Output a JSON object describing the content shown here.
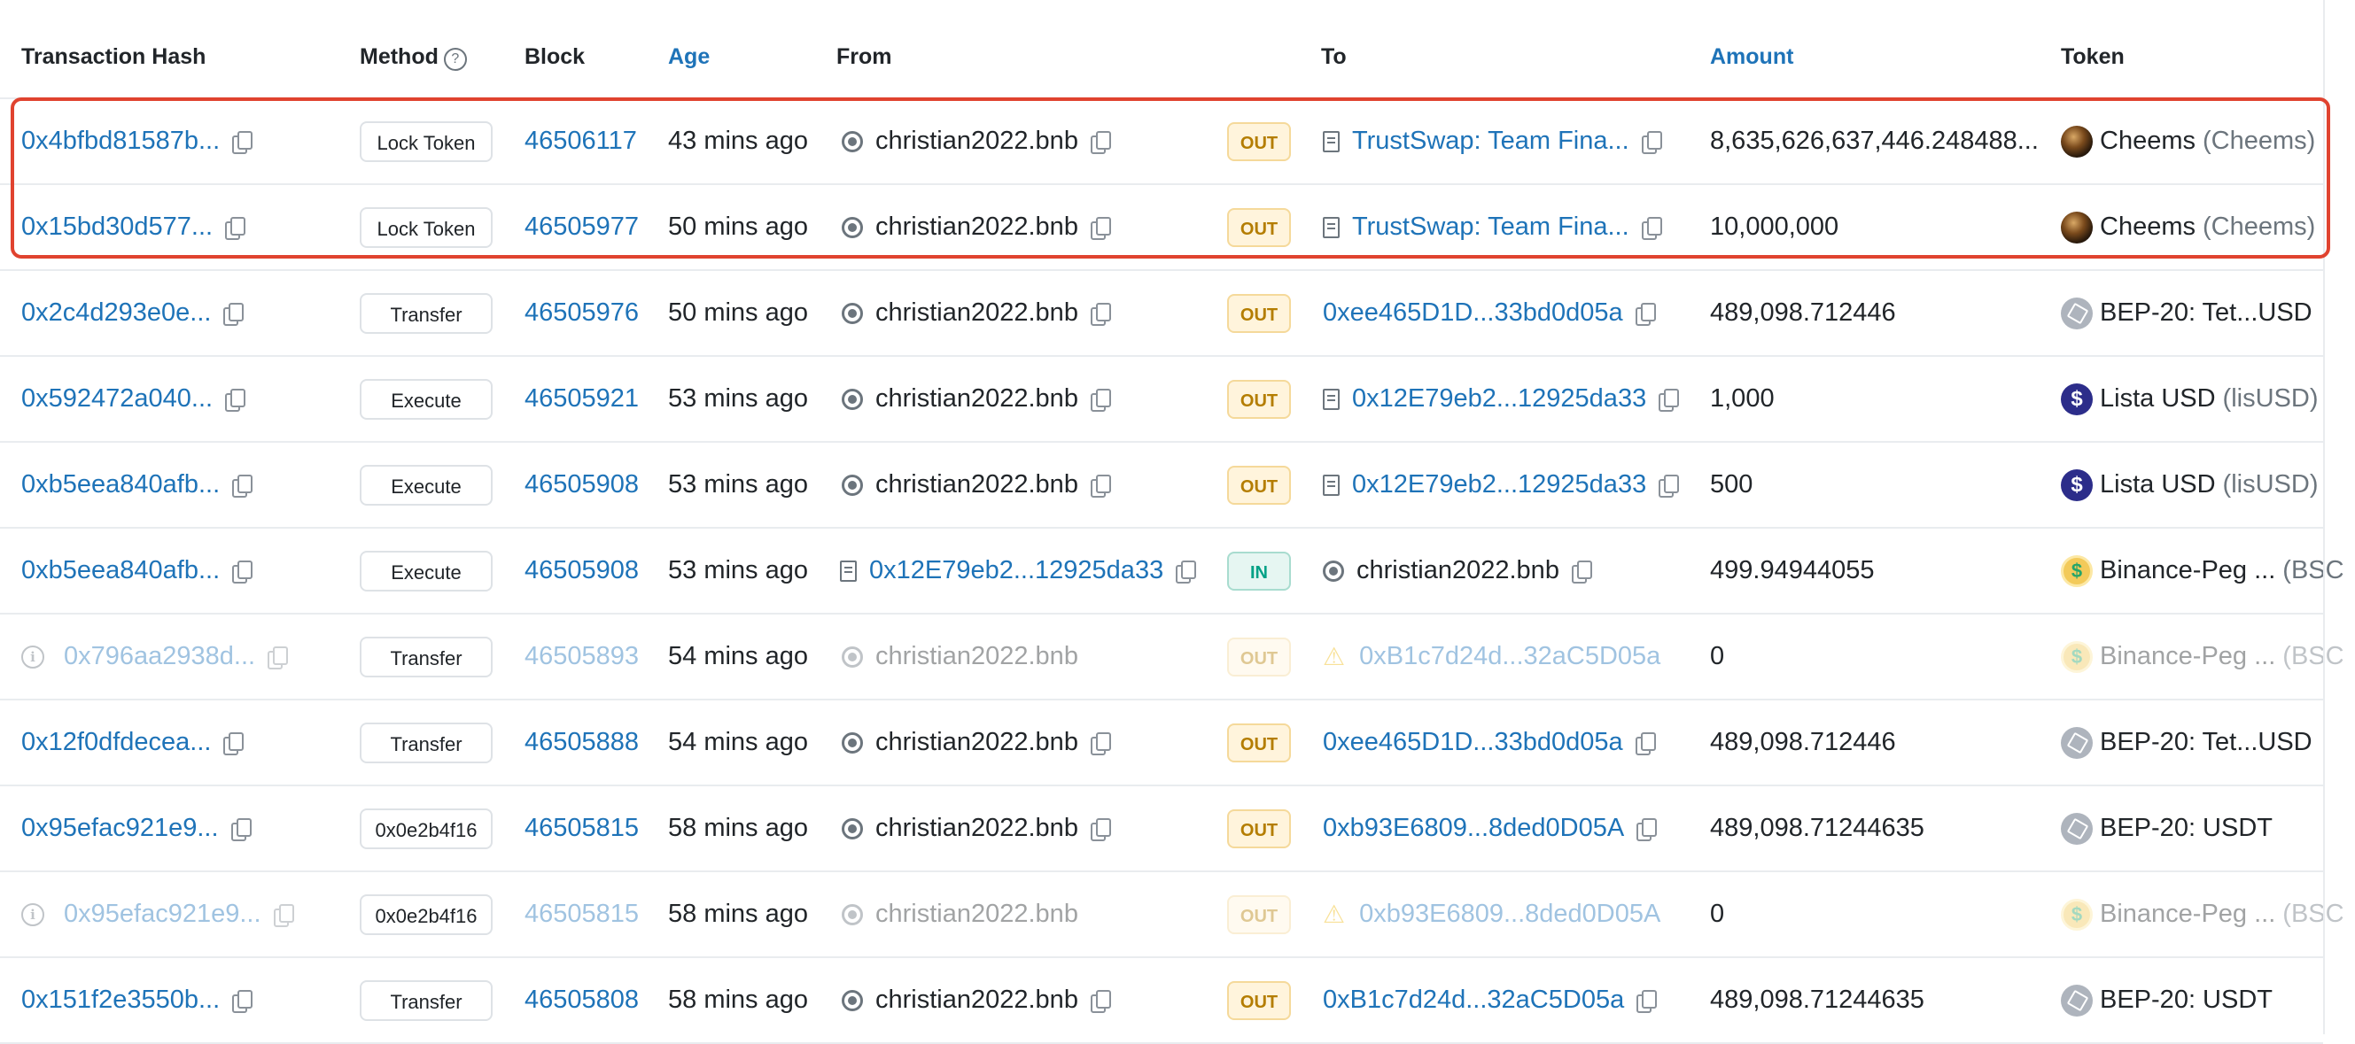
{
  "headers": {
    "tx_hash": "Transaction Hash",
    "method": "Method",
    "block": "Block",
    "age": "Age",
    "from": "From",
    "to": "To",
    "amount": "Amount",
    "token": "Token"
  },
  "icons": {
    "help": "question-circle-icon",
    "copy": "copy-icon",
    "wallet": "wallet-icon",
    "contract": "file-contract-icon",
    "warning": "warning-triangle-icon",
    "info": "info-circle-icon"
  },
  "colors": {
    "link": "#1e73b8",
    "out_badge": "#b47d00",
    "in_badge": "#00a186",
    "highlight_border": "#e0432f",
    "warning": "#f0b90b"
  },
  "rows": [
    {
      "hash": "0x4bfbd81587b...",
      "method": "Lock Token",
      "block": "46506117",
      "age": "43 mins ago",
      "from": "christian2022.bnb",
      "from_type": "wallet",
      "direction": "OUT",
      "to": "TrustSwap: Team Fina...",
      "to_type": "contract",
      "amount": "8,635,626,637,446.248488...",
      "token_name": "Cheems",
      "token_symbol": "(Cheems)",
      "token_logo": "cheems",
      "dim": false,
      "highlighted": true
    },
    {
      "hash": "0x15bd30d577...",
      "method": "Lock Token",
      "block": "46505977",
      "age": "50 mins ago",
      "from": "christian2022.bnb",
      "from_type": "wallet",
      "direction": "OUT",
      "to": "TrustSwap: Team Fina...",
      "to_type": "contract",
      "amount": "10,000,000",
      "token_name": "Cheems",
      "token_symbol": "(Cheems)",
      "token_logo": "cheems",
      "dim": false,
      "highlighted": true
    },
    {
      "hash": "0x2c4d293e0e...",
      "method": "Transfer",
      "block": "46505976",
      "age": "50 mins ago",
      "from": "christian2022.bnb",
      "from_type": "wallet",
      "direction": "OUT",
      "to": "0xee465D1D...33bd0d05a",
      "to_type": "address",
      "amount": "489,098.712446",
      "token_name": "BEP-20: Tet...USD",
      "token_symbol": "",
      "token_logo": "bep",
      "dim": false,
      "highlighted": false
    },
    {
      "hash": "0x592472a040...",
      "method": "Execute",
      "block": "46505921",
      "age": "53 mins ago",
      "from": "christian2022.bnb",
      "from_type": "wallet",
      "direction": "OUT",
      "to": "0x12E79eb2...12925da33",
      "to_type": "contract",
      "amount": "1,000",
      "token_name": "Lista USD",
      "token_symbol": "(lisUSD)",
      "token_logo": "lista",
      "dim": false,
      "highlighted": false
    },
    {
      "hash": "0xb5eea840afb...",
      "method": "Execute",
      "block": "46505908",
      "age": "53 mins ago",
      "from": "christian2022.bnb",
      "from_type": "wallet",
      "direction": "OUT",
      "to": "0x12E79eb2...12925da33",
      "to_type": "contract",
      "amount": "500",
      "token_name": "Lista USD",
      "token_symbol": "(lisUSD)",
      "token_logo": "lista",
      "dim": false,
      "highlighted": false
    },
    {
      "hash": "0xb5eea840afb...",
      "method": "Execute",
      "block": "46505908",
      "age": "53 mins ago",
      "from": "0x12E79eb2...12925da33",
      "from_type": "contract",
      "direction": "IN",
      "to": "christian2022.bnb",
      "to_type": "wallet",
      "amount": "499.94944055",
      "token_name": "Binance-Peg ...",
      "token_symbol": "(BSC",
      "token_logo": "binance",
      "dim": false,
      "highlighted": false
    },
    {
      "hash": "0x796aa2938d...",
      "method": "Transfer",
      "block": "46505893",
      "age": "54 mins ago",
      "from": "christian2022.bnb",
      "from_type": "wallet",
      "direction": "OUT",
      "to": "0xB1c7d24d...32aC5D05a",
      "to_type": "warning",
      "amount": "0",
      "token_name": "Binance-Peg ...",
      "token_symbol": "(BSC",
      "token_logo": "binance",
      "dim": true,
      "highlighted": false
    },
    {
      "hash": "0x12f0dfdecea...",
      "method": "Transfer",
      "block": "46505888",
      "age": "54 mins ago",
      "from": "christian2022.bnb",
      "from_type": "wallet",
      "direction": "OUT",
      "to": "0xee465D1D...33bd0d05a",
      "to_type": "address",
      "amount": "489,098.712446",
      "token_name": "BEP-20: Tet...USD",
      "token_symbol": "",
      "token_logo": "bep",
      "dim": false,
      "highlighted": false
    },
    {
      "hash": "0x95efac921e9...",
      "method": "0x0e2b4f16",
      "block": "46505815",
      "age": "58 mins ago",
      "from": "christian2022.bnb",
      "from_type": "wallet",
      "direction": "OUT",
      "to": "0xb93E6809...8ded0D05A",
      "to_type": "address",
      "amount": "489,098.71244635",
      "token_name": "BEP-20: USDT",
      "token_symbol": "",
      "token_logo": "bep",
      "dim": false,
      "highlighted": false
    },
    {
      "hash": "0x95efac921e9...",
      "method": "0x0e2b4f16",
      "block": "46505815",
      "age": "58 mins ago",
      "from": "christian2022.bnb",
      "from_type": "wallet",
      "direction": "OUT",
      "to": "0xb93E6809...8ded0D05A",
      "to_type": "warning",
      "amount": "0",
      "token_name": "Binance-Peg ...",
      "token_symbol": "(BSC",
      "token_logo": "binance",
      "dim": true,
      "highlighted": false
    },
    {
      "hash": "0x151f2e3550b...",
      "method": "Transfer",
      "block": "46505808",
      "age": "58 mins ago",
      "from": "christian2022.bnb",
      "from_type": "wallet",
      "direction": "OUT",
      "to": "0xB1c7d24d...32aC5D05a",
      "to_type": "address",
      "amount": "489,098.71244635",
      "token_name": "BEP-20: USDT",
      "token_symbol": "",
      "token_logo": "bep",
      "dim": false,
      "highlighted": false
    }
  ]
}
